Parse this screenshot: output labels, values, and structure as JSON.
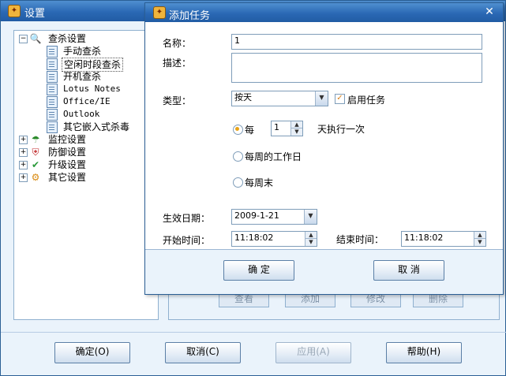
{
  "main": {
    "title": "设置",
    "tree": [
      {
        "label": "查杀设置",
        "kind": "group",
        "expander": "⊟",
        "icon": "magnifier-icon"
      },
      {
        "label": "手动查杀",
        "kind": "leaf"
      },
      {
        "label": "空闲时段查杀",
        "kind": "leaf",
        "selected": true
      },
      {
        "label": "开机查杀",
        "kind": "leaf"
      },
      {
        "label": "Lotus Notes",
        "kind": "leaf"
      },
      {
        "label": "Office/IE",
        "kind": "leaf"
      },
      {
        "label": "Outlook",
        "kind": "leaf"
      },
      {
        "label": "其它嵌入式杀毒",
        "kind": "leaf"
      },
      {
        "label": "监控设置",
        "kind": "group",
        "expander": "⊞",
        "icon": "umbrella-icon"
      },
      {
        "label": "防御设置",
        "kind": "group",
        "expander": "⊞",
        "icon": "shield-icon"
      },
      {
        "label": "升级设置",
        "kind": "group",
        "expander": "⊞",
        "icon": "update-check-icon"
      },
      {
        "label": "其它设置",
        "kind": "group",
        "expander": "⊞",
        "icon": "gear-icon"
      }
    ],
    "behind_buttons": [
      "查看",
      "添加",
      "修改",
      "删除"
    ],
    "buttons": {
      "ok": "确定(O)",
      "cancel": "取消(C)",
      "apply": "应用(A)",
      "help": "帮助(H)"
    }
  },
  "dialog": {
    "title": "添加任务",
    "name_label": "名称：",
    "name_value": "1",
    "desc_label": "描述：",
    "desc_value": "",
    "type_label": "类型：",
    "type_value": "按天",
    "enable_label": "启用任务",
    "enable_checked": true,
    "every_label": "每",
    "every_days": "1",
    "every_suffix": "天执行一次",
    "weekday_label": "每周的工作日",
    "weekend_label": "每周末",
    "selected_schedule": "every_n_days",
    "effective_date_label": "生效日期：",
    "effective_date_value": "2009-1-21",
    "start_time_label": "开始时间：",
    "start_time_value": "11:18:02",
    "end_time_label": "结束时间：",
    "end_time_value": "11:18:02",
    "ok_button": "确 定",
    "cancel_button": "取 消"
  },
  "colors": {
    "titlebar": "#2a68b4",
    "window_bg": "#eaf3fb",
    "radio_dot": "#e8a317",
    "check_mark": "#d9801a"
  }
}
